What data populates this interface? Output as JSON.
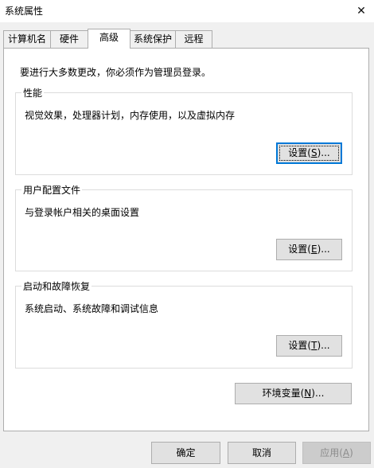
{
  "window": {
    "title": "系统属性",
    "close_glyph": "✕"
  },
  "tabs": [
    {
      "label": "计算机名"
    },
    {
      "label": "硬件"
    },
    {
      "label": "高级"
    },
    {
      "label": "系统保护"
    },
    {
      "label": "远程"
    }
  ],
  "active_tab": "高级",
  "intro": "要进行大多数更改，你必须作为管理员登录。",
  "performance": {
    "title": "性能",
    "description": "视觉效果，处理器计划，内存使用，以及虚拟内存",
    "button_prefix": "设置(",
    "button_key": "S",
    "button_suffix": ")..."
  },
  "user_profiles": {
    "title": "用户配置文件",
    "description": "与登录帐户相关的桌面设置",
    "button_prefix": "设置(",
    "button_key": "E",
    "button_suffix": ")..."
  },
  "startup_recovery": {
    "title": "启动和故障恢复",
    "description": "系统启动、系统故障和调试信息",
    "button_prefix": "设置(",
    "button_key": "T",
    "button_suffix": ")..."
  },
  "env_vars": {
    "prefix": "环境变量(",
    "key": "N",
    "suffix": ")..."
  },
  "footer": {
    "ok": "确定",
    "cancel": "取消",
    "apply_prefix": "应用(",
    "apply_key": "A",
    "apply_suffix": ")"
  },
  "colors": {
    "focus_border": "#0078d7",
    "button_bg": "#e1e1e1",
    "dialog_bg": "#f0f0f0"
  }
}
